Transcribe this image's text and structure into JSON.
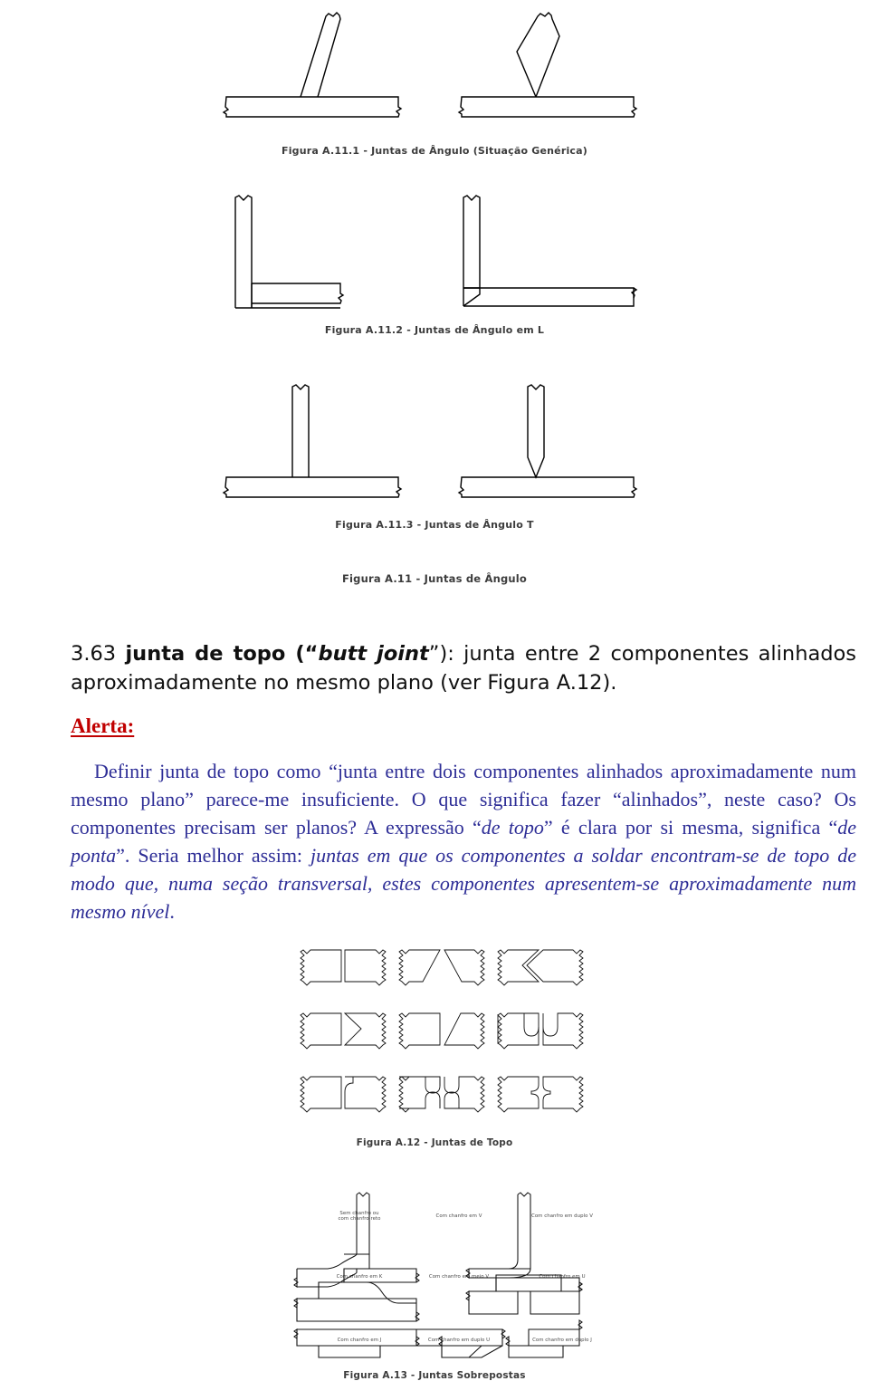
{
  "document": {
    "language": "pt-BR",
    "text_colors": {
      "heading": "#101010",
      "alert": "#c00000",
      "body": "#2d2d96",
      "caption": "#3c3c3c",
      "linework": "#000000"
    }
  },
  "figures": {
    "a11_1": {
      "caption": "Figura A.11.1 - Juntas de Ângulo (Situação Genérica)"
    },
    "a11_2": {
      "caption": "Figura A.11.2 - Juntas de Ângulo em L"
    },
    "a11_3": {
      "caption": "Figura A.11.3 - Juntas de Ângulo T"
    },
    "a11": {
      "caption": "Figura A.11 - Juntas de Ângulo"
    },
    "a12": {
      "caption": "Figura A.12 - Juntas de Topo",
      "labels": [
        "Sem chanfro ou\ncom chanfro reto",
        "Com chanfro em V",
        "Com chanfro em duplo V",
        "Com chanfro em K",
        "Com chanfro em meio V",
        "Com chanfro em U",
        "Com chanfro em J",
        "Com chanfro em duplo U",
        "Com chanfro em duplo J"
      ]
    },
    "a13": {
      "caption": "Figura A.13 - Juntas Sobrepostas"
    }
  },
  "content": {
    "clause_number": "3.63",
    "clause_term": "junta de topo",
    "clause_open_paren": " (“",
    "clause_english": "butt joint",
    "clause_close_paren": "”): ",
    "clause_definition": "junta entre 2 componentes alinhados aproximadamente no mesmo plano (ver Figura A.12).",
    "alert_label": "Alerta:",
    "alert_body_1": "Definir junta de topo como “junta entre dois componentes alinhados aproximadamente num mesmo plano” parece-me insuficiente. O que significa fazer “alinhados”, neste caso? Os componentes precisam ser planos? A expressão “",
    "alert_body_em_1": "de topo",
    "alert_body_2": "” é clara por si mesma, significa “",
    "alert_body_em_2": "de ponta",
    "alert_body_3": "”. Seria melhor assim: ",
    "alert_body_em_3": "juntas em que os componentes a soldar encontram-se de topo de modo que, numa seção transversal, estes componentes apresentem-se aproximadamente num mesmo nível",
    "alert_body_4": "."
  }
}
